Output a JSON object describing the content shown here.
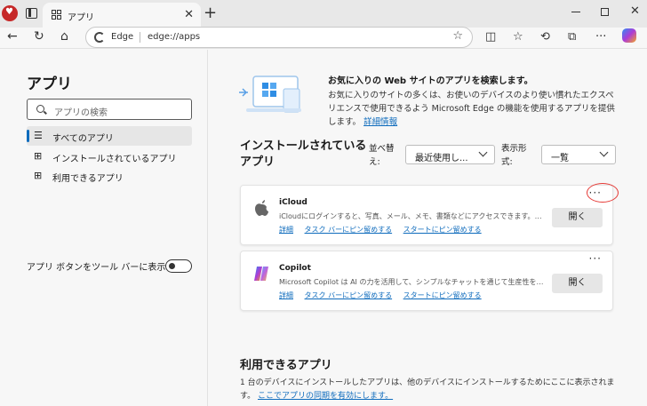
{
  "browser": {
    "tab_title": "アプリ",
    "omnibox_label": "Edge",
    "url": "edge://apps"
  },
  "sidebar": {
    "title": "アプリ",
    "search_placeholder": "アプリの検索",
    "items": [
      {
        "label": "すべてのアプリ",
        "active": true
      },
      {
        "label": "インストールされているアプリ",
        "active": false
      },
      {
        "label": "利用できるアプリ",
        "active": false
      }
    ],
    "toggle_label": "アプリ ボタンをツール バーに表示する",
    "toggle_on": false
  },
  "promo": {
    "title": "お気に入りの Web サイトのアプリを検索します。",
    "text": "お気に入りのサイトの多くは、お使いのデバイスのより使い慣れたエクスペリエンスで使用できるよう Microsoft Edge の機能を使用するアプリを提供します。",
    "link": "詳細情報"
  },
  "installed": {
    "title": "インストールされているアプリ",
    "sort_label": "並べ替え:",
    "sort_value": "最近使用し...",
    "view_label": "表示形式:",
    "view_value": "一覧",
    "apps": [
      {
        "name": "iCloud",
        "description": "iCloudにログインすると、写真、メール、メモ、書類などにアクセスできます。Appleのサービス...",
        "links": [
          "詳細",
          "タスク バーにピン留めする",
          "スタートにピン留めする"
        ],
        "open_label": "開く",
        "more": "···"
      },
      {
        "name": "Copilot",
        "description": "Microsoft Copilot は AI の力を活用して、シンプルなチャットを通じて生産性を高め、創...",
        "links": [
          "詳細",
          "タスク バーにピン留めする",
          "スタートにピン留めする"
        ],
        "open_label": "開く",
        "more": "···"
      }
    ]
  },
  "available": {
    "title": "利用できるアプリ",
    "text": "1 台のデバイスにインストールしたアプリは、他のデバイスにインストールするためにここに表示されます。",
    "link": "ここでアプリの同期を有効にします。"
  },
  "colors": {
    "accent": "#0f6cbd",
    "highlight": "#e53935"
  }
}
